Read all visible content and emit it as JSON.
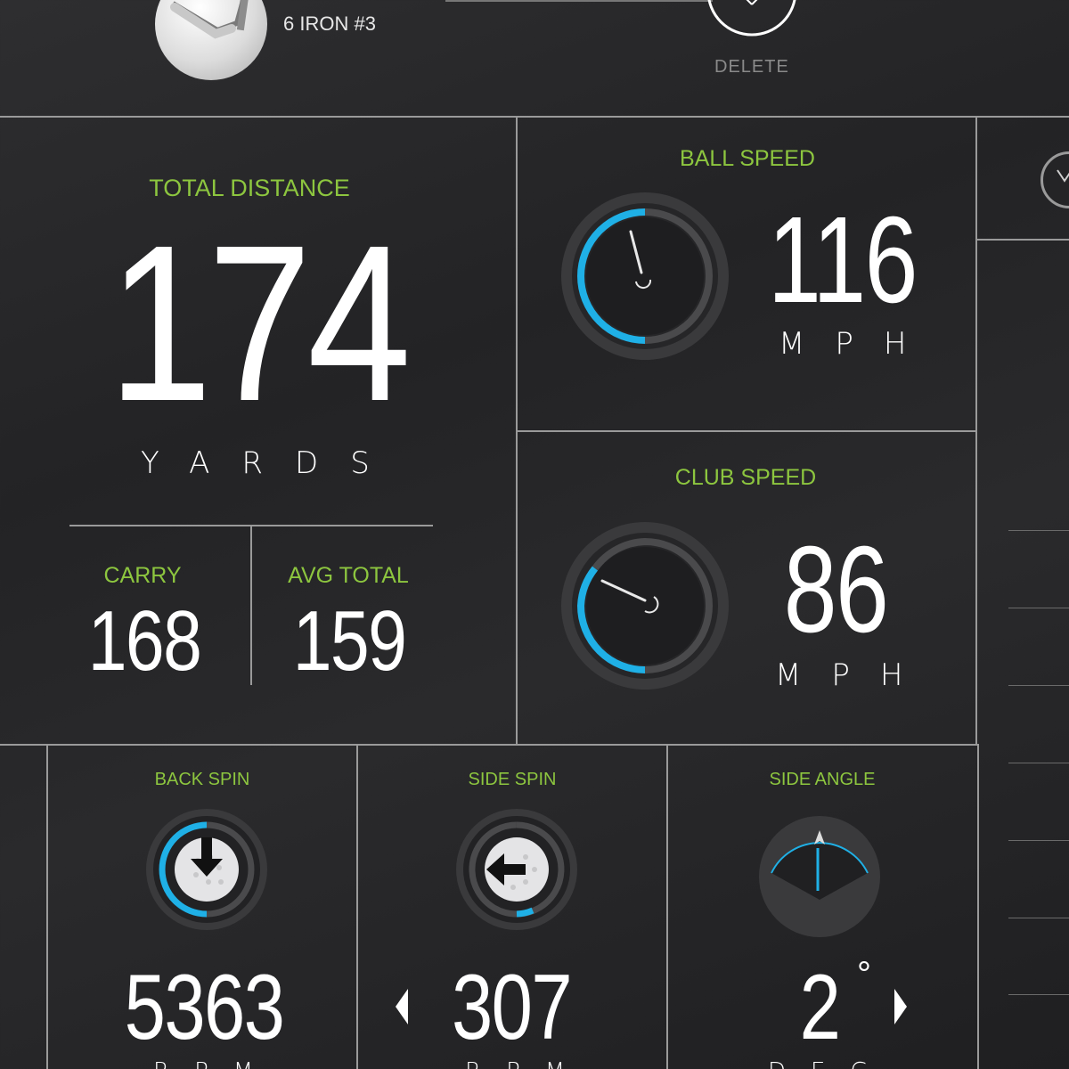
{
  "header": {
    "club_name": "6 IRON #3",
    "delete_label": "DELETE"
  },
  "total_distance": {
    "label": "TOTAL DISTANCE",
    "value": "174",
    "unit": "YARDS"
  },
  "carry": {
    "label": "CARRY",
    "value": "168"
  },
  "avg_total": {
    "label": "AVG TOTAL",
    "value": "159"
  },
  "ball_speed": {
    "label": "BALL SPEED",
    "value": "116",
    "unit": "MPH"
  },
  "club_speed": {
    "label": "CLUB SPEED",
    "value": "86",
    "unit": "MPH"
  },
  "back_spin": {
    "label": "BACK SPIN",
    "value": "5363",
    "unit": "RPM"
  },
  "side_spin": {
    "label": "SIDE SPIN",
    "value": "307",
    "unit": "RPM"
  },
  "side_angle": {
    "label": "SIDE ANGLE",
    "value": "2",
    "degree": "°",
    "unit": "DEG"
  },
  "colors": {
    "accent_green": "#8dc63f",
    "gauge_blue": "#1fb0e6",
    "divider": "#9a9a9a"
  }
}
